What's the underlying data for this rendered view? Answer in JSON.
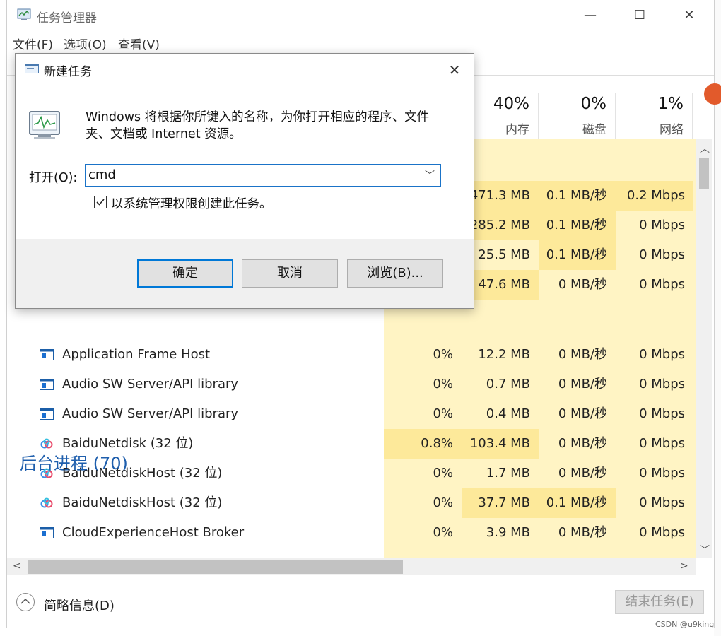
{
  "window": {
    "title": "任务管理器",
    "menus": [
      "文件(F)",
      "选项(O)",
      "查看(V)"
    ],
    "caption_buttons": [
      "—",
      "☐",
      "✕"
    ]
  },
  "columns": [
    {
      "pct": "40%",
      "label": "内存"
    },
    {
      "pct": "0%",
      "label": "磁盘"
    },
    {
      "pct": "1%",
      "label": "网络"
    }
  ],
  "app_rows": [
    {
      "cpu": "",
      "mem": "471.3 MB",
      "disk": "0.1 MB/秒",
      "net": "0.2 Mbps"
    },
    {
      "cpu": "",
      "mem": "285.2 MB",
      "disk": "0.1 MB/秒",
      "net": "0 Mbps"
    },
    {
      "cpu": "",
      "mem": "25.5 MB",
      "disk": "0.1 MB/秒",
      "net": "0 Mbps"
    },
    {
      "cpu": "",
      "mem": "47.6 MB",
      "disk": "0 MB/秒",
      "net": "0 Mbps"
    }
  ],
  "section_title": "后台进程 (70)",
  "bg_rows": [
    {
      "icon": "app-frame-icon",
      "name": "Application Frame Host",
      "cpu": "0%",
      "mem": "12.2 MB",
      "disk": "0 MB/秒",
      "net": "0 Mbps"
    },
    {
      "icon": "app-frame-icon",
      "name": "Audio SW Server/API library",
      "cpu": "0%",
      "mem": "0.7 MB",
      "disk": "0 MB/秒",
      "net": "0 Mbps"
    },
    {
      "icon": "app-frame-icon",
      "name": "Audio SW Server/API library",
      "cpu": "0%",
      "mem": "0.4 MB",
      "disk": "0 MB/秒",
      "net": "0 Mbps"
    },
    {
      "icon": "baidu-cloud-icon",
      "name": "BaiduNetdisk (32 位)",
      "cpu": "0.8%",
      "mem": "103.4 MB",
      "disk": "0 MB/秒",
      "net": "0 Mbps"
    },
    {
      "icon": "baidu-cloud-icon",
      "name": "BaiduNetdiskHost (32 位)",
      "cpu": "0%",
      "mem": "1.7 MB",
      "disk": "0 MB/秒",
      "net": "0 Mbps"
    },
    {
      "icon": "baidu-cloud-icon",
      "name": "BaiduNetdiskHost (32 位)",
      "cpu": "0%",
      "mem": "37.7 MB",
      "disk": "0.1 MB/秒",
      "net": "0 Mbps"
    },
    {
      "icon": "app-frame-icon",
      "name": "CloudExperienceHost Broker",
      "cpu": "0%",
      "mem": "3.9 MB",
      "disk": "0 MB/秒",
      "net": "0 Mbps"
    }
  ],
  "footer": {
    "collapse_label": "简略信息(D)",
    "end_task": "结束任务(E)"
  },
  "watermark": "CSDN @u9king",
  "dialog": {
    "title": "新建任务",
    "description": "Windows 将根据你所键入的名称，为你打开相应的程序、文件夹、文档或 Internet 资源。",
    "open_label": "打开(O):",
    "open_value": "cmd",
    "admin_label": "以系统管理权限创建此任务。",
    "admin_checked": true,
    "ok": "确定",
    "cancel": "取消",
    "browse": "浏览(B)..."
  },
  "colors": {
    "cell_bg": "#fff4c4",
    "cell_highlight": "#fde99a",
    "section_title": "#1f5fad",
    "default_button_border": "#0078d7"
  }
}
